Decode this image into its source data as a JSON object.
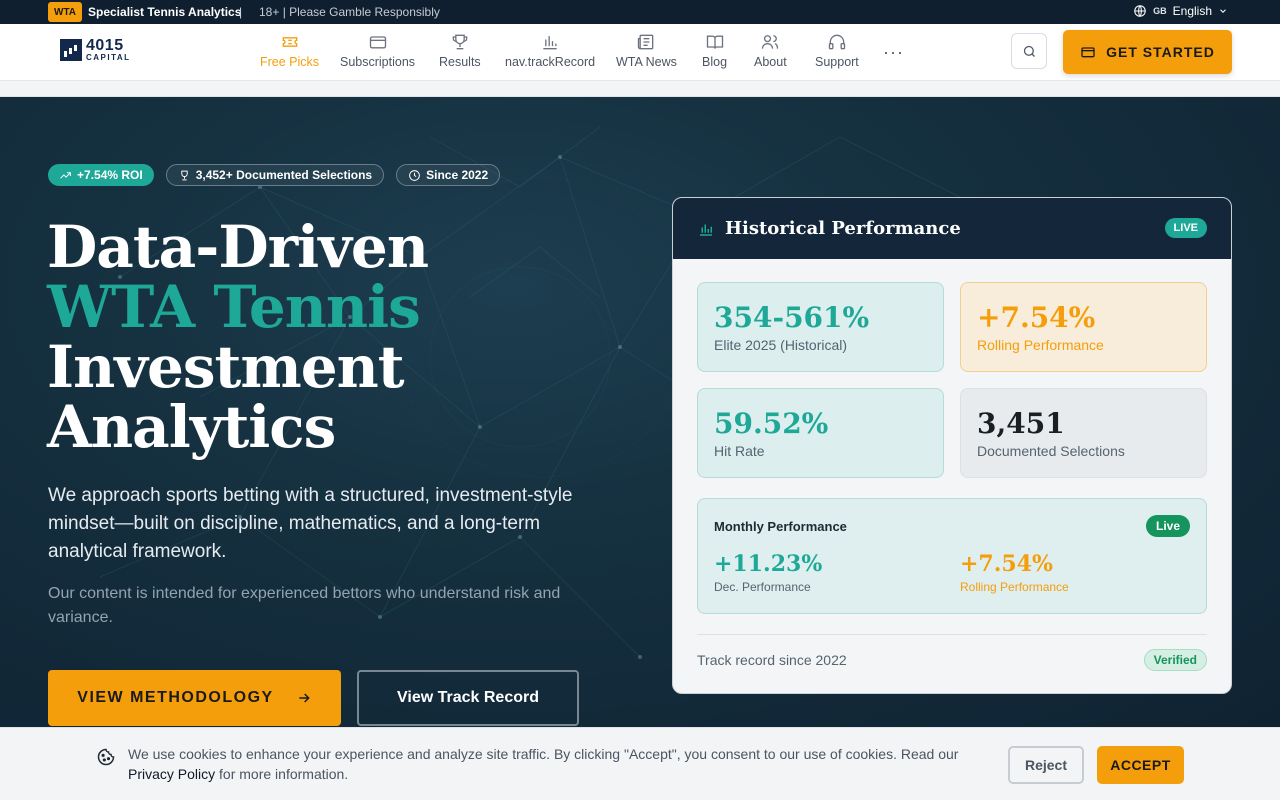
{
  "topbar": {
    "badge": "WTA",
    "brand": "Specialist Tennis Analytics",
    "separator": "|",
    "notice": "18+ | Please Gamble Responsibly",
    "lang_code": "GB",
    "language": "English"
  },
  "nav": {
    "logo_line1": "4015",
    "logo_line2": "CAPITAL",
    "items": [
      {
        "label": "Free Picks",
        "icon": "ticket-icon",
        "active": true
      },
      {
        "label": "Subscriptions",
        "icon": "card-icon"
      },
      {
        "label": "Results",
        "icon": "trophy-icon"
      },
      {
        "label": "nav.trackRecord",
        "icon": "bar-chart-icon"
      },
      {
        "label": "WTA News",
        "icon": "newspaper-icon"
      },
      {
        "label": "Blog",
        "icon": "book-icon"
      },
      {
        "label": "About",
        "icon": "users-icon"
      },
      {
        "label": "Support",
        "icon": "headphones-icon"
      }
    ],
    "more": "···",
    "cta": "GET STARTED"
  },
  "hero": {
    "badges": [
      "+7.54% ROI",
      "3,452+ Documented Selections",
      "Since 2022"
    ],
    "headline_1": "Data-Driven",
    "headline_2": "WTA Tennis",
    "headline_3": "Investment",
    "headline_4": "Analytics",
    "lead": "We approach sports betting with a structured, investment-style mindset—built on discipline, mathematics, and a long-term analytical framework.",
    "sub": "Our content is intended for experienced bettors who understand risk and variance.",
    "btn_methodology": "VIEW METHODOLOGY",
    "btn_track": "View Track Record"
  },
  "card": {
    "title": "Historical Performance",
    "live": "LIVE",
    "stats": [
      {
        "value": "354-561%",
        "label": "Elite 2025 (Historical)"
      },
      {
        "value": "+7.54%",
        "label": "Rolling Performance"
      },
      {
        "value": "59.52%",
        "label": "Hit Rate"
      },
      {
        "value": "3,451",
        "label": "Documented Selections"
      }
    ],
    "monthly_title": "Monthly Performance",
    "monthly_live": "Live",
    "monthly": [
      {
        "value": "+11.23%",
        "label": "Dec. Performance"
      },
      {
        "value": "+7.54%",
        "label": "Rolling Performance"
      }
    ],
    "footer": "Track record since 2022",
    "verified": "Verified"
  },
  "cookie": {
    "text": "We use cookies to enhance your experience and analyze site traffic. By clicking \"Accept\", you consent to our use of cookies. Read our ",
    "link": "Privacy Policy",
    "text_end": " for more information.",
    "reject": "Reject",
    "accept": "ACCEPT"
  },
  "colors": {
    "accent": "#f59e0b",
    "teal": "#1ea897",
    "navy": "#13263a"
  }
}
